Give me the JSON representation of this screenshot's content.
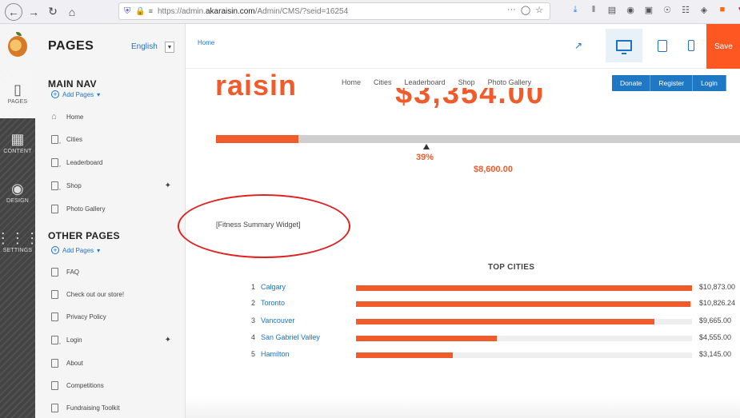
{
  "browser": {
    "url_prefix": "https://admin.",
    "url_host": "akaraisin.com",
    "url_path": "/Admin/CMS/?seid=16254",
    "url_more": "···"
  },
  "rail": {
    "items": [
      {
        "label": "PAGES",
        "icon": "page-icon"
      },
      {
        "label": "CONTENT",
        "icon": "grid-icon"
      },
      {
        "label": "DESIGN",
        "icon": "paint-bucket-icon"
      },
      {
        "label": "SETTINGS",
        "icon": "sliders-icon"
      }
    ]
  },
  "panel": {
    "title": "PAGES",
    "language": "English",
    "main_nav": {
      "title": "MAIN NAV",
      "add_label": "Add Pages",
      "items": [
        {
          "label": "Home",
          "icon": "home-icon"
        },
        {
          "label": "Cities",
          "icon": "page-settings-icon"
        },
        {
          "label": "Leaderboard",
          "icon": "page-settings-icon"
        },
        {
          "label": "Shop",
          "icon": "page-settings-icon",
          "expandable": true
        },
        {
          "label": "Photo Gallery",
          "icon": "page-icon"
        }
      ]
    },
    "other_pages": {
      "title": "OTHER PAGES",
      "add_label": "Add Pages",
      "items": [
        {
          "label": "FAQ",
          "icon": "page-icon"
        },
        {
          "label": "Check out our store!",
          "icon": "page-icon"
        },
        {
          "label": "Privacy Policy",
          "icon": "page-icon"
        },
        {
          "label": "Login",
          "icon": "page-settings-icon",
          "expandable": true
        },
        {
          "label": "About",
          "icon": "page-icon"
        },
        {
          "label": "Competitions",
          "icon": "page-icon"
        },
        {
          "label": "Fundraising Toolkit",
          "icon": "page-icon"
        }
      ]
    }
  },
  "preview_bar": {
    "breadcrumb": "Home",
    "save_label": "Save"
  },
  "site": {
    "logo": "raisin",
    "nav": [
      "Home",
      "Cities",
      "Leaderboard",
      "Shop",
      "Photo Gallery"
    ],
    "buttons": [
      "Donate",
      "Register",
      "Login"
    ],
    "amount_raised": "$3,354.00",
    "progress_percent": 39,
    "progress_label": "39%",
    "goal_amount": "$8,600.00",
    "widget_placeholder": "[Fitness Summary Widget]",
    "top_cities": {
      "title": "TOP CITIES",
      "rows": [
        {
          "rank": "1",
          "name": "Calgary",
          "amount": "$10,873.00",
          "fraction": 1.0
        },
        {
          "rank": "2",
          "name": "Toronto",
          "amount": "$10,826.24",
          "fraction": 0.996
        },
        {
          "rank": "3",
          "name": "Vancouver",
          "amount": "$9,665.00",
          "fraction": 0.889
        },
        {
          "rank": "4",
          "name": "San Gabriel Valley",
          "amount": "$4,555.00",
          "fraction": 0.419
        },
        {
          "rank": "5",
          "name": "Hamilton",
          "amount": "$3,145.00",
          "fraction": 0.289
        }
      ]
    }
  },
  "colors": {
    "brand_orange": "#ef5b2b",
    "link_blue": "#1a73c8",
    "annotation_red": "#e02020"
  }
}
